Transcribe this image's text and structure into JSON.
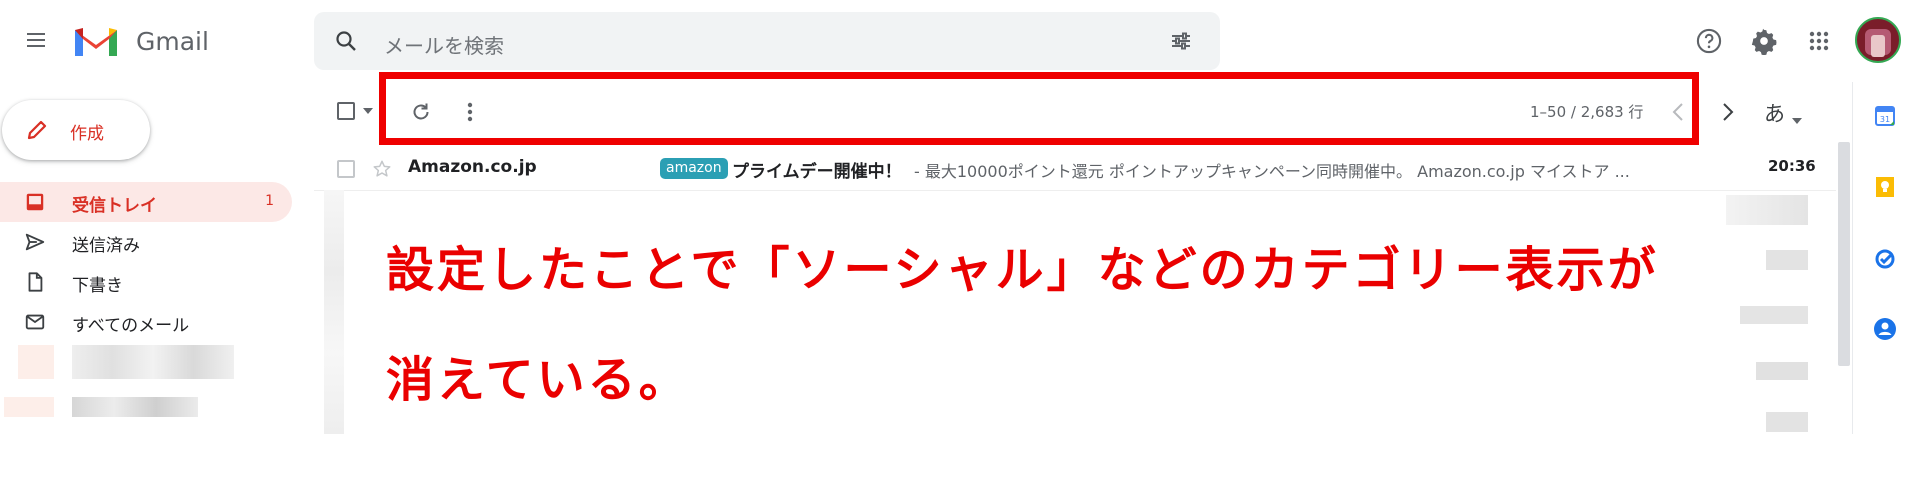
{
  "header": {
    "app_name": "Gmail",
    "search_placeholder": "メールを検索"
  },
  "sidebar": {
    "compose_label": "作成",
    "items": [
      {
        "label": "受信トレイ",
        "count": "1",
        "icon": "inbox-icon",
        "active": true
      },
      {
        "label": "送信済み",
        "icon": "send-icon"
      },
      {
        "label": "下書き",
        "icon": "draft-icon"
      },
      {
        "label": "すべてのメール",
        "icon": "mail-icon"
      }
    ]
  },
  "toolbar": {
    "pagination": "1–50 / 2,683 行",
    "input_tool_label": "あ"
  },
  "email_rows": [
    {
      "sender": "Amazon.co.jp",
      "badge": "amazon",
      "subject": "プライムデー開催中！",
      "snippet": "- 最大10000ポイント還元 ポイントアップキャンペーン同時開催中。 Amazon.co.jp マイストア ...",
      "time": "20:36"
    }
  ],
  "annotation": {
    "line1": "設定したことで「ソーシャル」などのカテゴリー表示が",
    "line2": "消えている。"
  },
  "colors": {
    "accent_red": "#ea0000",
    "inbox_active_bg": "#fce8e6",
    "amazon_badge": "#2b9fb4"
  }
}
